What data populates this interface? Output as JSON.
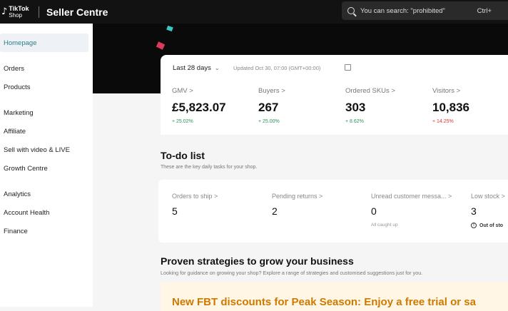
{
  "header": {
    "logo_line1": "TikTok",
    "logo_line2": "Shop",
    "app_title": "Seller Centre",
    "search_placeholder": "You can search: \"prohibited\"",
    "search_shortcut": "Ctrl+"
  },
  "sidebar": {
    "items": [
      {
        "label": "Homepage",
        "active": true
      },
      {
        "label": "Orders"
      },
      {
        "label": "Products"
      },
      {
        "label": "Marketing"
      },
      {
        "label": "Affiliate"
      },
      {
        "label": "Sell with video & LIVE"
      },
      {
        "label": "Growth Centre"
      },
      {
        "label": "Analytics"
      },
      {
        "label": "Account Health"
      },
      {
        "label": "Finance"
      }
    ]
  },
  "stats": {
    "period": "Last 28 days",
    "updated": "Updated Oct 30, 07:00 (GMT+00:00)",
    "metrics": [
      {
        "label": "GMV >",
        "value": "£5,823.07",
        "change": "+ 25.02%"
      },
      {
        "label": "Buyers >",
        "value": "267",
        "change": "+ 25.00%"
      },
      {
        "label": "Ordered SKUs >",
        "value": "303",
        "change": "+ 8.62%"
      },
      {
        "label": "Visitors >",
        "value": "10,836",
        "change": "+ 14.25%"
      }
    ]
  },
  "todo": {
    "title": "To-do list",
    "subtitle": "These are the key daily tasks for your shop.",
    "tasks": [
      {
        "label": "Orders to ship >",
        "value": "5"
      },
      {
        "label": "Pending returns >",
        "value": "2"
      },
      {
        "label": "Unread customer messa... >",
        "value": "0",
        "note": "All caught up"
      },
      {
        "label": "Low stock >",
        "value": "3",
        "note": "Out of sto"
      }
    ]
  },
  "strategies": {
    "title": "Proven strategies to grow your business",
    "subtitle": "Looking for guidance on growing your shop? Explore a range of strategies and customised suggestions just for you.",
    "promo": "New FBT discounts for Peak Season: Enjoy a free trial or sa"
  },
  "colors": {
    "accent": "#2f7f87",
    "positive": "#2f8f5a",
    "negative": "#d33333",
    "promo": "#cc7a00"
  }
}
